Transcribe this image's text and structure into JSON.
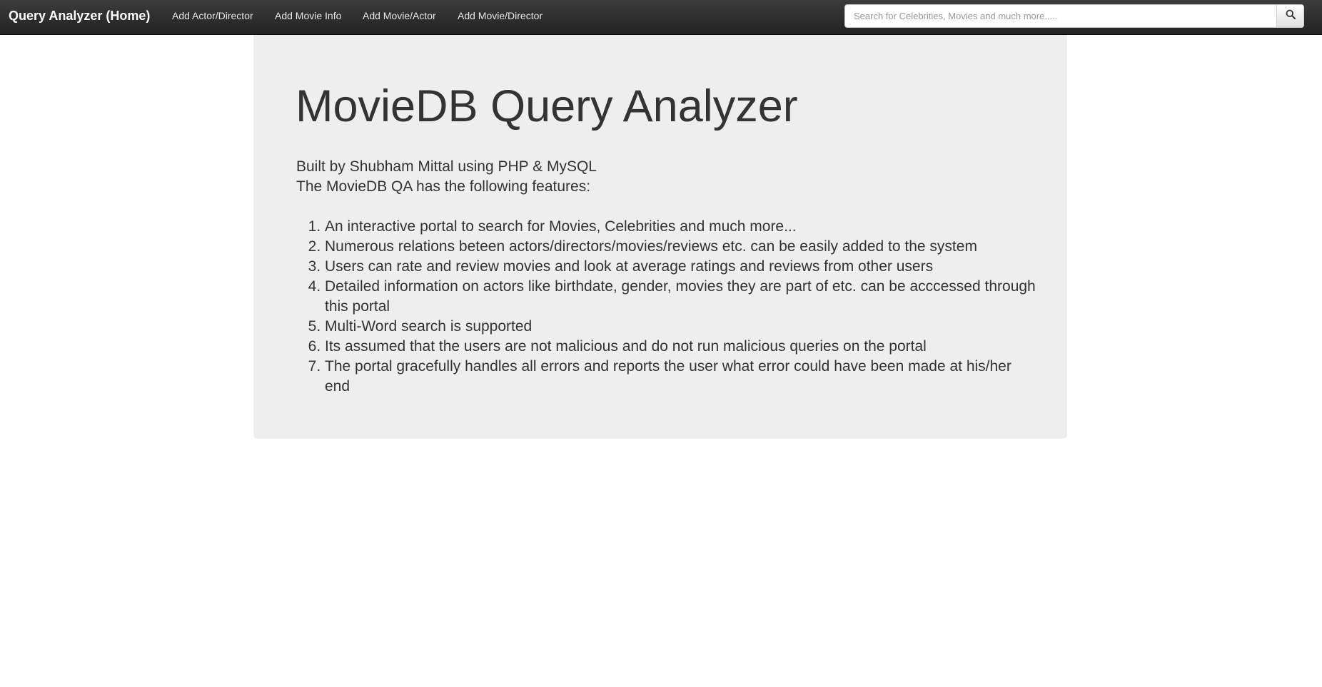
{
  "navbar": {
    "brand": "Query Analyzer (Home)",
    "links": [
      {
        "label": "Add Actor/Director"
      },
      {
        "label": "Add Movie Info"
      },
      {
        "label": "Add Movie/Actor"
      },
      {
        "label": "Add Movie/Director"
      }
    ],
    "search": {
      "placeholder": "Search for Celebrities, Movies and much more.....",
      "value": "",
      "button_icon": "search-icon"
    },
    "background_color": "#222222"
  },
  "main": {
    "title": "MovieDB Query Analyzer",
    "intro_line_1": "Built by Shubham Mittal using PHP & MySQL",
    "intro_line_2": "The MovieDB QA has the following features:",
    "features": [
      "An interactive portal to search for Movies, Celebrities and much more...",
      "Numerous relations beteen actors/directors/movies/reviews etc. can be easily added to the system",
      "Users can rate and review movies and look at average ratings and reviews from other users",
      "Detailed information on actors like birthdate, gender, movies they are part of etc. can be acccessed through this portal",
      "Multi-Word search is supported",
      "Its assumed that the users are not malicious and do not run malicious queries on the portal",
      "The portal gracefully handles all errors and reports the user what error could have been made at his/her end"
    ],
    "background_color": "#eeeeee"
  }
}
